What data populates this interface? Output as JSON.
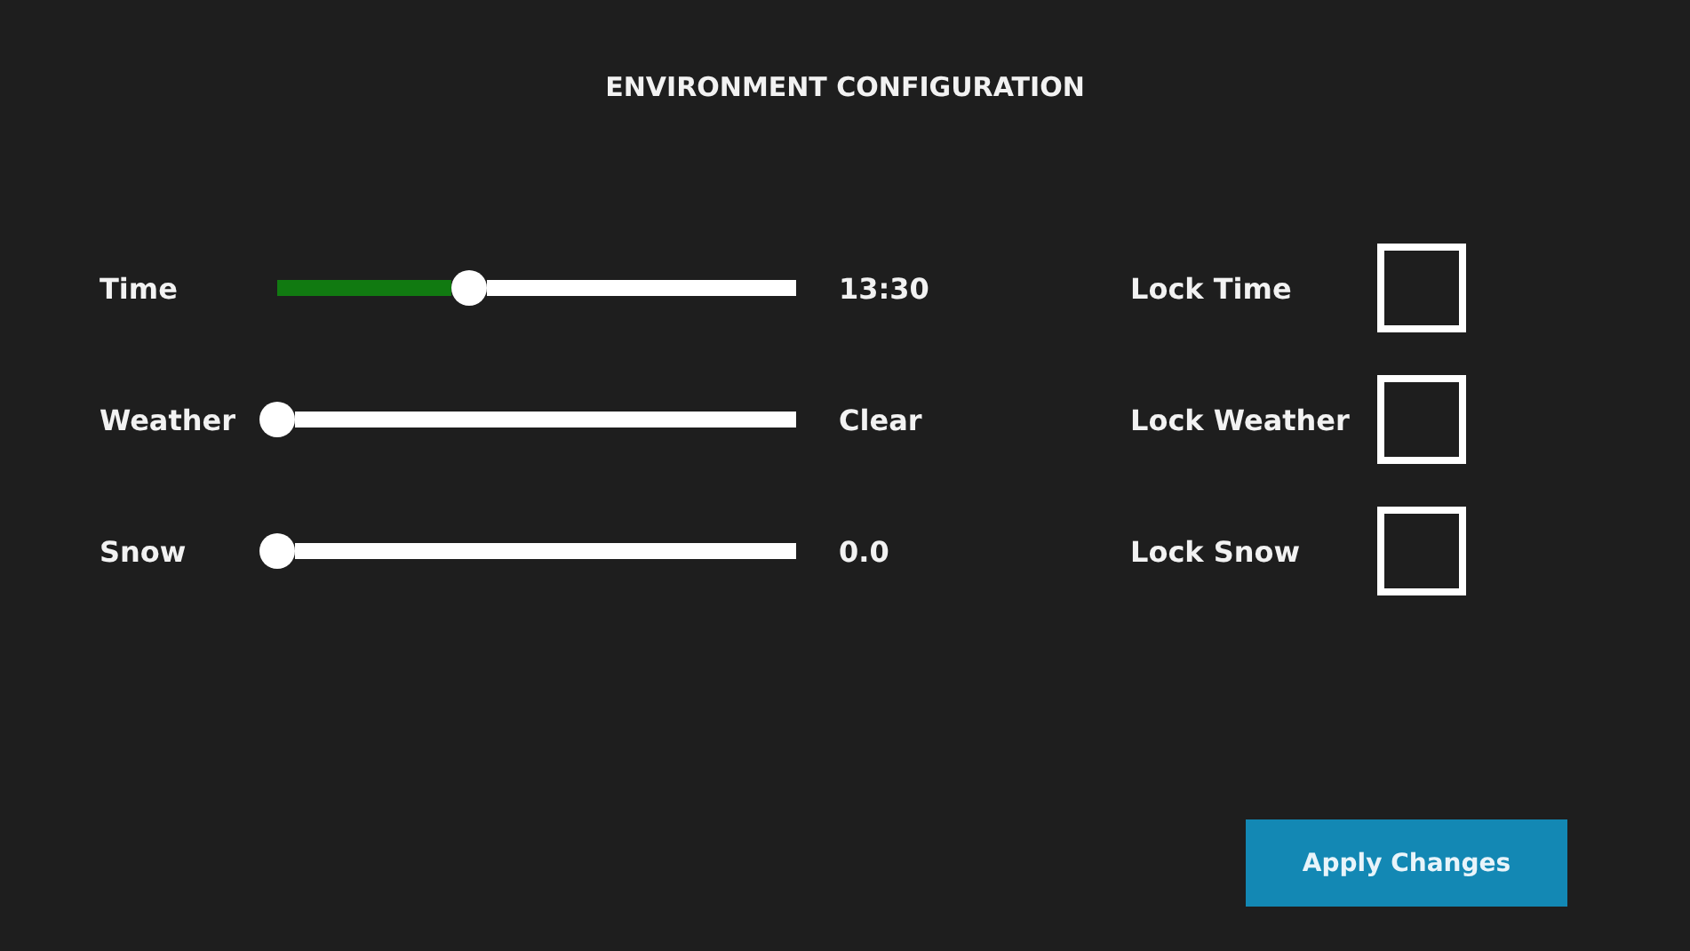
{
  "title": "ENVIRONMENT CONFIGURATION",
  "settings": [
    {
      "label": "Time",
      "level": 0.37,
      "reading": "13:30",
      "lock_label": "Lock Time",
      "checked": false
    },
    {
      "label": "Weather",
      "level": 0,
      "reading": "Clear",
      "lock_label": "Lock Weather",
      "checked": false
    },
    {
      "label": "Snow",
      "level": 0,
      "reading": "0.0",
      "lock_label": "Lock Snow",
      "checked": false
    }
  ],
  "apply_button": "Apply Changes"
}
